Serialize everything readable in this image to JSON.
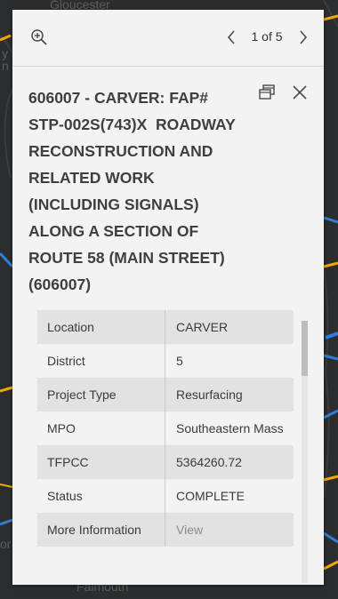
{
  "map": {
    "labels": [
      "Gloucester",
      "Falmouth",
      "y",
      "n",
      "or"
    ]
  },
  "popup": {
    "header": {
      "zoom_icon": "zoom-in-icon",
      "prev_icon": "chevron-left-icon",
      "next_icon": "chevron-right-icon",
      "pager": "1 of 5"
    },
    "title": "606007 - CARVER: FAP#\nSTP-002S(743)X  ROADWAY\nRECONSTRUCTION AND\nRELATED WORK\n(INCLUDING SIGNALS)\nALONG A SECTION OF\nROUTE 58 (MAIN STREET)\n(606007)",
    "dock_icon": "dock-icon",
    "close_icon": "close-icon",
    "rows": [
      {
        "key": "Location",
        "value": "CARVER"
      },
      {
        "key": "District",
        "value": "5"
      },
      {
        "key": "Project Type",
        "value": "Resurfacing"
      },
      {
        "key": "MPO",
        "value": "Southeastern Mass"
      },
      {
        "key": "TFPCC",
        "value": "5364260.72"
      },
      {
        "key": "Status",
        "value": "COMPLETE"
      },
      {
        "key": "More Information",
        "value": "View"
      }
    ]
  },
  "colors": {
    "map_bg": "#2b2d2f",
    "route_orange": "#f2a900",
    "route_blue": "#2f7fd8",
    "panel_bg": "#f3f3f3",
    "row_alt": "#e2e2e2"
  }
}
